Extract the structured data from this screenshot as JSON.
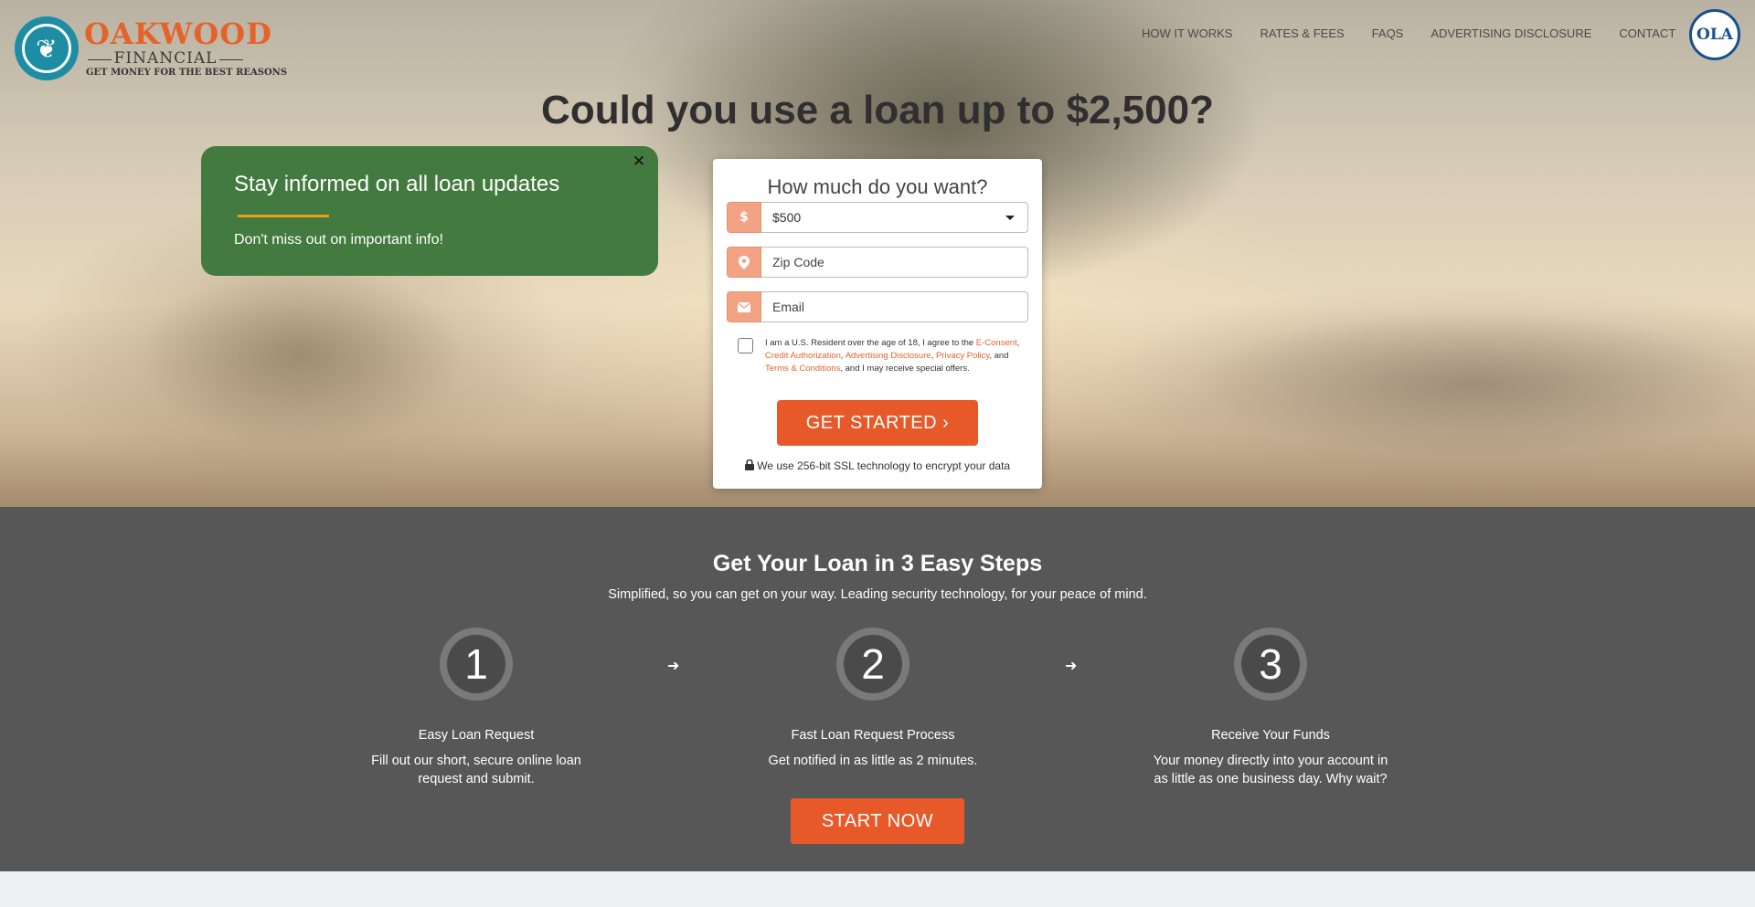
{
  "brand": {
    "name": "OAKWOOD",
    "sub": "FINANCIAL",
    "tagline": "GET MONEY FOR THE BEST REASONS",
    "badge": "OLA"
  },
  "nav": {
    "items": [
      "HOW IT WORKS",
      "RATES & FEES",
      "FAQS",
      "ADVERTISING DISCLOSURE",
      "CONTACT"
    ]
  },
  "hero": {
    "title": "Could you use a loan up to $2,500?"
  },
  "popup": {
    "title": "Stay informed on all loan updates",
    "text": "Don't miss out on important info!",
    "close": "✕"
  },
  "form": {
    "title": "How much do you want?",
    "amount_icon": "$",
    "amount_value": "$500",
    "zip_placeholder": "Zip Code",
    "email_placeholder": "Email",
    "consent": {
      "pre": "I am a U.S. Resident over the age of 18, I agree to the ",
      "link1": "E-Consent",
      "sep1": ", ",
      "link2": "Credit Authorization",
      "sep2": ", ",
      "link3": "Advertising Disclosure",
      "sep3": ", ",
      "link4": "Privacy Policy",
      "sep4": ", and ",
      "link5": "Terms & Conditions",
      "post": ", and I may receive special offers."
    },
    "cta": "GET STARTED ›",
    "secure_note": "We use 256-bit SSL technology to encrypt your data"
  },
  "steps": {
    "title": "Get Your Loan in 3 Easy Steps",
    "subtitle": "Simplified, so you can get on your way. Leading security technology, for your peace of mind.",
    "items": [
      {
        "num": "1",
        "title": "Easy Loan Request",
        "desc": "Fill out our short, secure online loan request and submit."
      },
      {
        "num": "2",
        "title": "Fast Loan Request Process",
        "desc": "Get notified in as little as 2 minutes."
      },
      {
        "num": "3",
        "title": "Receive Your Funds",
        "desc": "Your money directly into your account in as little as one business day. Why wait?"
      }
    ],
    "cta": "START NOW"
  },
  "colors": {
    "accent": "#e8592a",
    "popup_green": "#437a3f",
    "steps_bg": "#575757",
    "brand_teal": "#1e8da3"
  }
}
